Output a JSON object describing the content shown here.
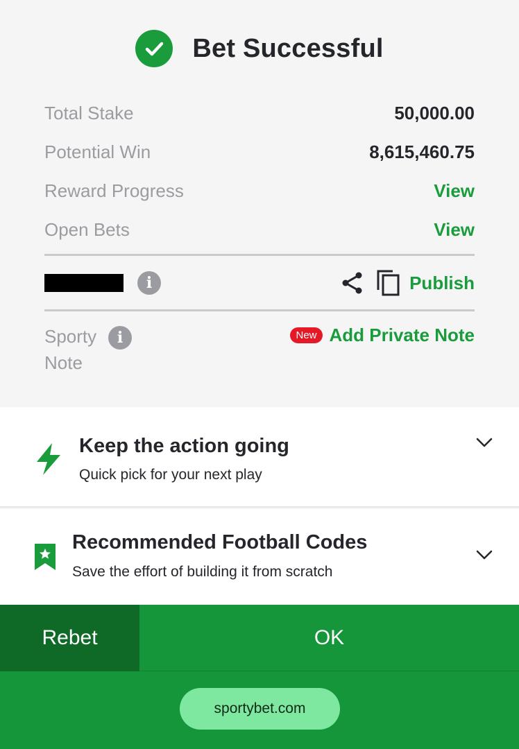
{
  "header": {
    "title": "Bet Successful",
    "icon": "check-circle-icon",
    "accent": "#1a9c3c"
  },
  "summary": {
    "total_stake_label": "Total Stake",
    "total_stake_value": "50,000.00",
    "potential_win_label": "Potential Win",
    "potential_win_value": "8,615,460.75",
    "reward_progress_label": "Reward Progress",
    "reward_progress_link": "View",
    "open_bets_label": "Open Bets",
    "open_bets_link": "View"
  },
  "booking": {
    "publish_label": "Publish"
  },
  "note": {
    "label_line1": "Sporty",
    "label_line2": "Note",
    "badge": "New",
    "add_label": "Add Private Note"
  },
  "promos": [
    {
      "title": "Keep the action going",
      "subtitle": "Quick pick for your next play",
      "icon": "lightning-icon"
    },
    {
      "title": "Recommended Football Codes",
      "subtitle": "Save the effort of building it from scratch",
      "icon": "bookmark-star-icon"
    }
  ],
  "actions": {
    "rebet_label": "Rebet",
    "ok_label": "OK"
  },
  "browser": {
    "url": "sportybet.com"
  },
  "colors": {
    "brand_green": "#16963a",
    "dark_green": "#0f6a27",
    "link_green": "#1a9c3c",
    "new_red": "#e41827"
  }
}
